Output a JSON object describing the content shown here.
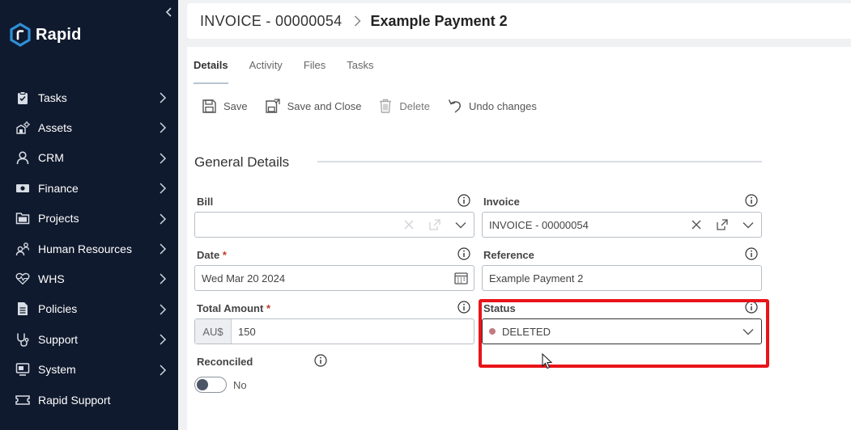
{
  "app": {
    "brand": "Rapid",
    "brand_color": "#2f8fd8",
    "sidebar_bg": "#101a2e"
  },
  "sidebar": {
    "items": [
      {
        "label": "Tasks",
        "icon": "clipboard-icon",
        "has_submenu": true
      },
      {
        "label": "Assets",
        "icon": "assets-icon",
        "has_submenu": true
      },
      {
        "label": "CRM",
        "icon": "user-icon",
        "has_submenu": true
      },
      {
        "label": "Finance",
        "icon": "money-icon",
        "has_submenu": true
      },
      {
        "label": "Projects",
        "icon": "folder-icon",
        "has_submenu": true
      },
      {
        "label": "Human Resources",
        "icon": "people-icon",
        "has_submenu": true
      },
      {
        "label": "WHS",
        "icon": "heartbeat-icon",
        "has_submenu": true
      },
      {
        "label": "Policies",
        "icon": "document-icon",
        "has_submenu": true
      },
      {
        "label": "Support",
        "icon": "stethoscope-icon",
        "has_submenu": true
      },
      {
        "label": "System",
        "icon": "system-icon",
        "has_submenu": true
      },
      {
        "label": "Rapid Support",
        "icon": "ticket-icon",
        "has_submenu": false
      }
    ]
  },
  "header": {
    "document": "INVOICE - 00000054",
    "title": "Example Payment 2"
  },
  "tabs": [
    {
      "label": "Details",
      "active": true
    },
    {
      "label": "Activity",
      "active": false
    },
    {
      "label": "Files",
      "active": false
    },
    {
      "label": "Tasks",
      "active": false
    }
  ],
  "toolbar": {
    "save": "Save",
    "save_close": "Save and Close",
    "delete": "Delete",
    "undo": "Undo changes"
  },
  "section": {
    "title": "General Details"
  },
  "form": {
    "bill": {
      "label": "Bill",
      "value": ""
    },
    "invoice": {
      "label": "Invoice",
      "value": "INVOICE - 00000054"
    },
    "date": {
      "label": "Date",
      "required_mark": "*",
      "value": "Wed Mar 20 2024"
    },
    "reference": {
      "label": "Reference",
      "value": "Example Payment 2"
    },
    "total_amount": {
      "label": "Total Amount",
      "required_mark": "*",
      "currency": "AU$",
      "value": "150"
    },
    "status": {
      "label": "Status",
      "value": "DELETED",
      "dot_color": "#c07a80"
    },
    "reconciled": {
      "label": "Reconciled",
      "value": "No",
      "checked": false
    }
  },
  "highlight_color": "#e8141a"
}
